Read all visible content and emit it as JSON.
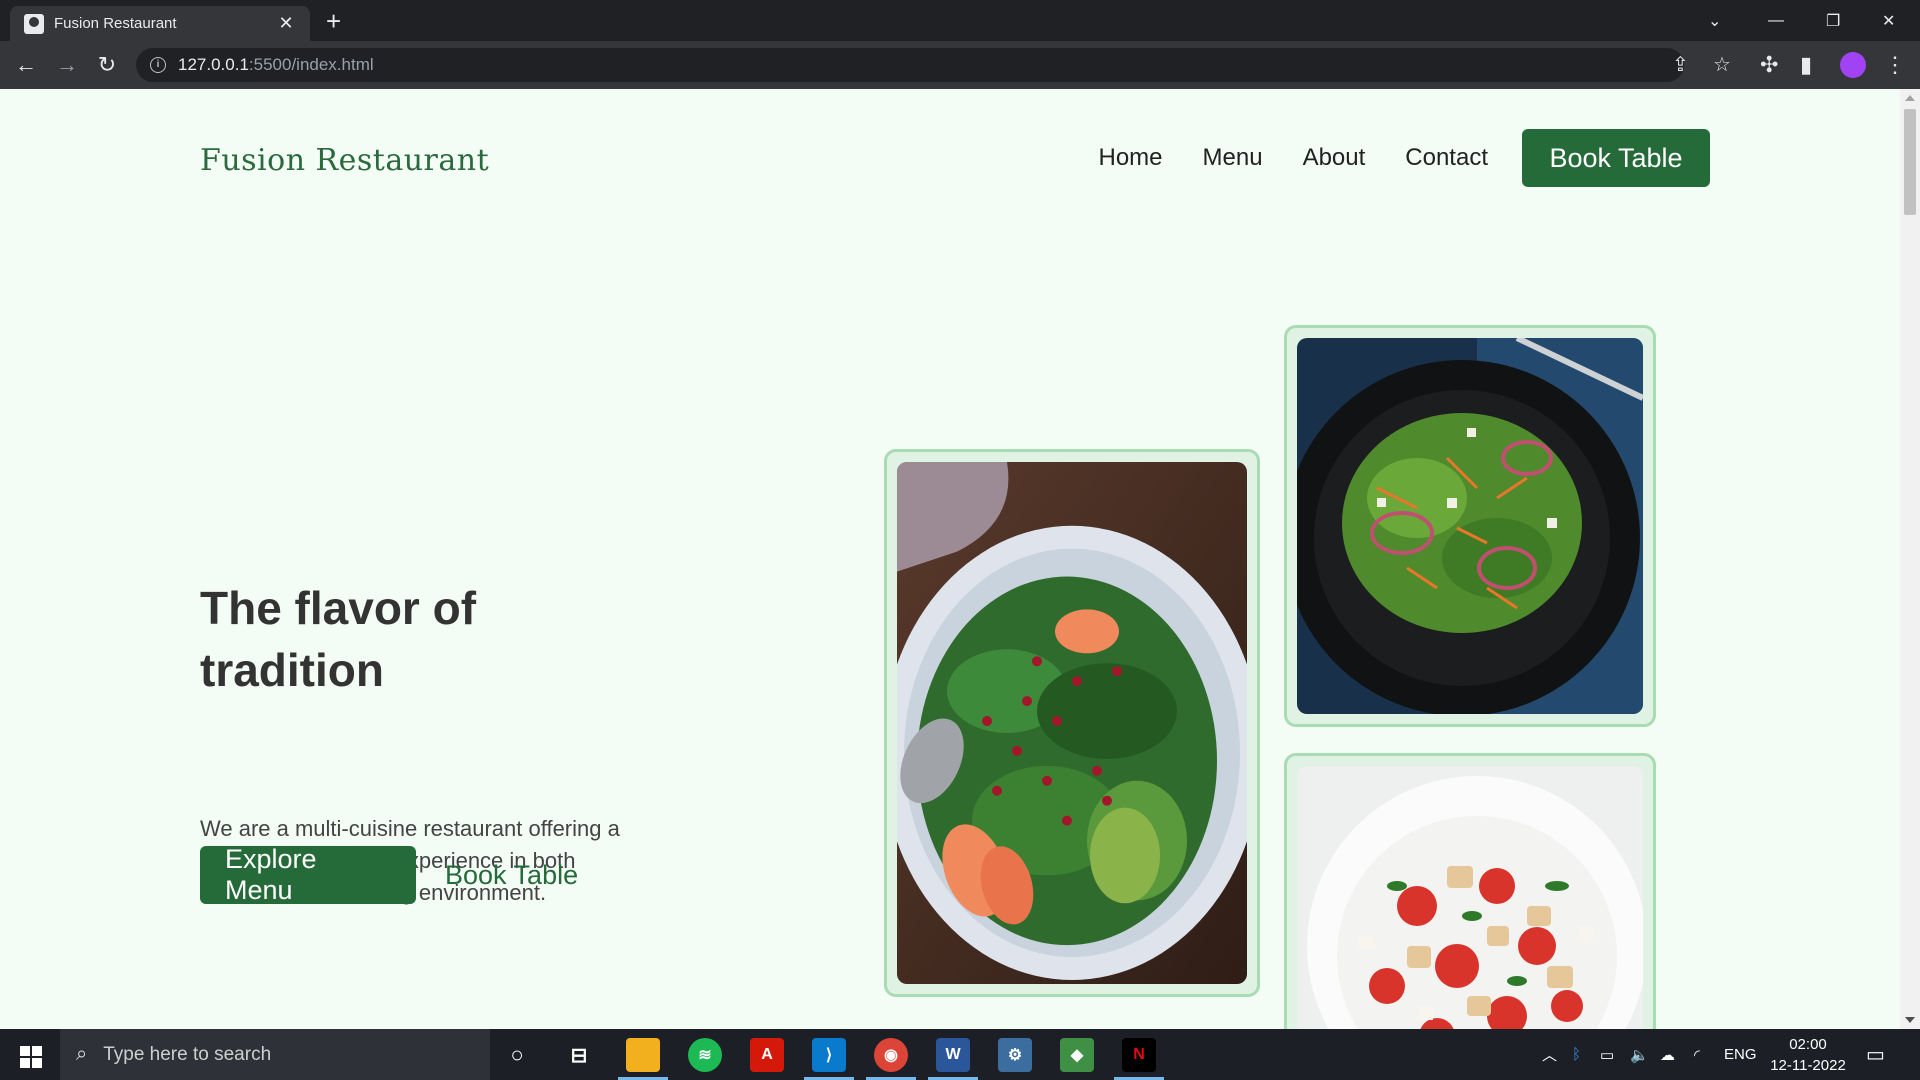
{
  "browser": {
    "tab_title": "Fusion Restaurant",
    "tab_close": "✕",
    "new_tab": "+",
    "url_host": "127.0.0.1",
    "url_path": ":5500/index.html"
  },
  "site": {
    "logo": "Fusion Restaurant",
    "nav": {
      "home": "Home",
      "menu": "Menu",
      "about": "About",
      "contact": "Contact",
      "book_table": "Book Table"
    },
    "hero": {
      "title": "The flavor of tradition",
      "description": "We are a multi-cuisine restaurant offering a wide variety of food experience in both casual and fine dining environment.",
      "primary_cta": "Explore Menu",
      "secondary_cta": "Book Table"
    },
    "images": [
      {
        "name": "spinach-pomegranate-salad"
      },
      {
        "name": "green-salad-black-plate"
      },
      {
        "name": "tomato-bread-salad"
      }
    ],
    "colors": {
      "brand_green": "#256b3a",
      "background": "#f4fcf6",
      "image_border": "#a8dcb1"
    }
  },
  "taskbar": {
    "search_placeholder": "Type here to search",
    "language": "ENG",
    "time": "02:00",
    "date": "12-11-2022"
  }
}
